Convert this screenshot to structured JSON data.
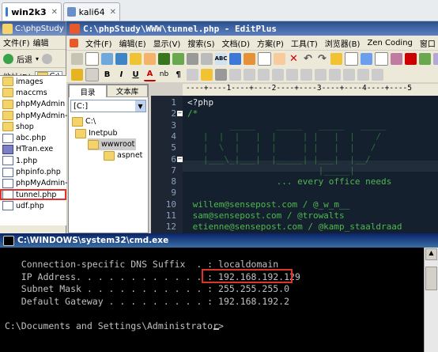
{
  "vm_tabs": [
    {
      "label": "win2k3",
      "active": true
    },
    {
      "label": "kali64",
      "active": false
    }
  ],
  "explorer": {
    "title": "C:\\phpStudy",
    "menu": [
      "文件(F)",
      "编辑"
    ],
    "back_label": "后退",
    "address_label": "地址(D)",
    "address_value": "C:\\",
    "column_header": "名称",
    "files": [
      {
        "name": "images",
        "kind": "folder"
      },
      {
        "name": "maccms",
        "kind": "folder"
      },
      {
        "name": "phpMyAdmin",
        "kind": "folder"
      },
      {
        "name": "phpMyAdmin---",
        "kind": "folder"
      },
      {
        "name": "shop",
        "kind": "folder"
      },
      {
        "name": "abc.php",
        "kind": "php"
      },
      {
        "name": "HTran.exe",
        "kind": "exe"
      },
      {
        "name": "1.php",
        "kind": "php"
      },
      {
        "name": "phpinfo.php",
        "kind": "php"
      },
      {
        "name": "phpMyAdmin-4",
        "kind": "php"
      },
      {
        "name": "tunnel.php",
        "kind": "php",
        "highlighted": true
      },
      {
        "name": "udf.php",
        "kind": "php"
      }
    ]
  },
  "editplus": {
    "title": "C:\\phpStudy\\WWW\\tunnel.php - EditPlus",
    "menu": [
      "文件(F)",
      "编辑(E)",
      "显示(V)",
      "搜索(S)",
      "文档(D)",
      "方案(P)",
      "工具(T)",
      "浏览器(B)",
      "Zen Coding",
      "窗口"
    ],
    "font_buttons": [
      "B",
      "I",
      "U",
      "A",
      "nb",
      "¶"
    ],
    "dir_tabs": [
      "目录",
      "文本库"
    ],
    "drive": "[C:]",
    "tree": [
      "C:\\",
      "Inetpub",
      "wwwroot",
      "aspnet"
    ],
    "ruler": "----+----1----+----2----+----3----+----4----+----5",
    "lines": [
      {
        "n": "1",
        "text": "<?php",
        "color": "#e8e8e8"
      },
      {
        "n": "2",
        "text": "/*",
        "color": "#4fb84f"
      },
      {
        "n": "3",
        "text": "        _____    _____   _____   _____ ",
        "color": "#2d6b3a"
      },
      {
        "n": "4",
        "text": "   |  |  |   |  |     | |   |  |    /",
        "color": "#2d6b3a"
      },
      {
        "n": "5",
        "text": "   |  \\  |   |  |     | |   |  |   /",
        "color": "#2d6b3a"
      },
      {
        "n": "6",
        "text": "   |___\\_|___|  |_____| |___|  |__/",
        "color": "#2d6b3a"
      },
      {
        "n": "7",
        "text": "                         |_____|",
        "color": "#2d6b3a"
      },
      {
        "n": "8",
        "text": "                 ... every office needs",
        "color": "#4fb84f"
      },
      {
        "n": "9",
        "text": "",
        "color": "#4fb84f"
      },
      {
        "n": "10",
        "text": " willem@sensepost.com / @_w_m__",
        "color": "#4fb84f"
      },
      {
        "n": "11",
        "text": " sam@sensepost.com / @trowalts",
        "color": "#4fb84f"
      },
      {
        "n": "12",
        "text": " etienne@sensepost.com / @kamp_staaldraad",
        "color": "#4fb84f"
      }
    ]
  },
  "cmd": {
    "title": "C:\\WINDOWS\\system32\\cmd.exe",
    "lines": [
      "   Connection-specific DNS Suffix  . : localdomain",
      "   IP Address. . . . . . . . . . . . : 192.168.192.129",
      "   Subnet Mask . . . . . . . . . . . : 255.255.255.0",
      "   Default Gateway . . . . . . . . . : 192.168.192.2",
      "",
      "C:\\Documents and Settings\\Administrator>"
    ],
    "ip_value": "192.168.192.129"
  }
}
